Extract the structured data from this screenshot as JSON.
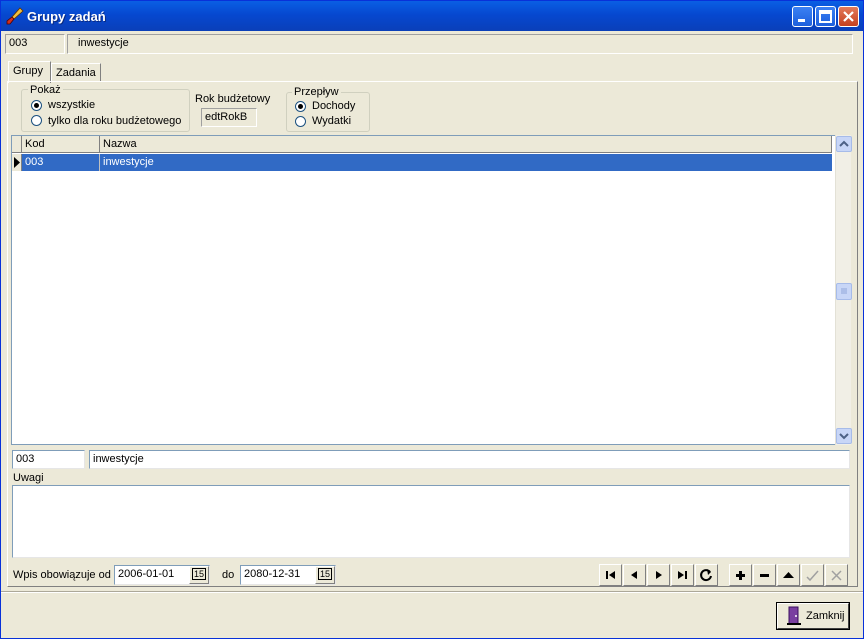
{
  "window": {
    "title": "Grupy zadań",
    "icon": "brush-icon"
  },
  "header": {
    "code": "003",
    "name": "inwestycje"
  },
  "tabs": [
    {
      "label": "Grupy"
    },
    {
      "label": "Zadania"
    }
  ],
  "filter": {
    "show_label": "Pokaż",
    "show_all": "wszystkie",
    "show_year": "tylko dla roku budżetowego",
    "year_label": "Rok budżetowy",
    "year_value": "edtRokB",
    "flow_label": "Przepływ",
    "flow_income": "Dochody",
    "flow_expense": "Wydatki"
  },
  "grid": {
    "columns": [
      "Kod",
      "Nazwa"
    ],
    "rows": [
      {
        "kod": "003",
        "nazwa": "inwestycje"
      }
    ]
  },
  "detail": {
    "code": "003",
    "name": "inwestycje",
    "notes_label": "Uwagi",
    "notes_value": ""
  },
  "validity": {
    "from_label": "Wpis obowiązuje od",
    "from_value": "2006-01-01",
    "to_label": "do",
    "to_value": "2080-12-31",
    "calendar_glyph": "15"
  },
  "buttons": {
    "close_label": "Zamknij"
  },
  "colors": {
    "selection": "#316ac5",
    "face": "#ece9d8",
    "titlebar": "#0a5fe4"
  }
}
